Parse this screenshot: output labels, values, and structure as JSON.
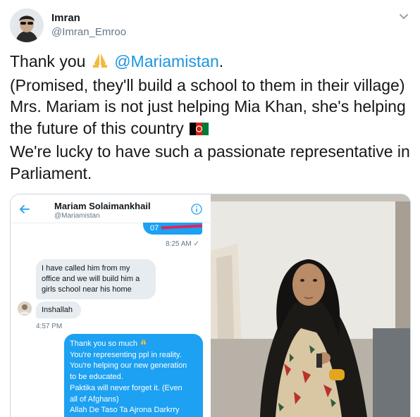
{
  "user": {
    "name": "Imran",
    "handle": "@Imran_Emroo"
  },
  "tweet": {
    "line1_prefix": "Thank you",
    "line1_mention": "@Mariamistan",
    "line1_suffix": ".",
    "line2": "(Promised, they'll build a school to them in their village)",
    "line3": "Mrs. Mariam is not just helping Mia Khan, she's helping",
    "line4": "the future of this country",
    "line5": "We're lucky to have such a passionate representative in",
    "line6": "Parliament."
  },
  "icons": {
    "chevron": "chevron-down-icon",
    "prayer": "folded-hands-emoji",
    "flag": "afghanistan-flag-emoji"
  },
  "dm": {
    "contact_name": "Mariam Solaimankhail",
    "contact_handle": "@Mariamistan",
    "outgoing_number": "07",
    "time_sent": "8:25 AM ✓",
    "incoming_1": "I have called him from my office and we will build him a girls school near his home",
    "incoming_2": "Inshallah",
    "time_received": "4:57 PM",
    "outgoing_lines": [
      "Thank you so much",
      "You're representing ppl in reality.",
      "You're helping our new generation",
      "to be educated.",
      "Paktika will never forget it. (Even",
      "all of Afghans)",
      "Allah De Taso Ta Ajrona Darkrry"
    ]
  },
  "colors": {
    "accent": "#1da1f2",
    "mention": "#1b95e0",
    "secondary_text": "#657786",
    "redaction": "#e0245e"
  }
}
